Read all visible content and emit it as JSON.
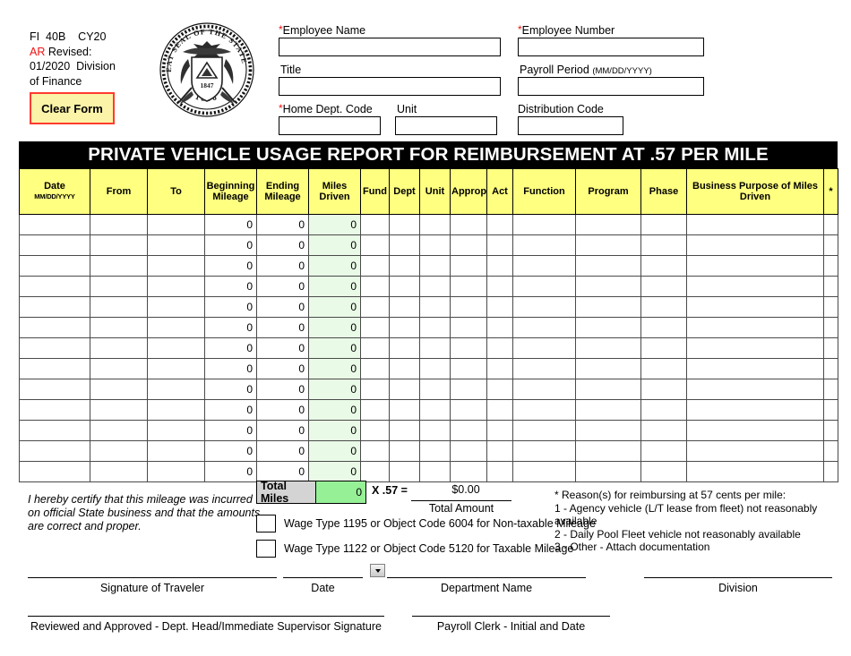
{
  "meta": {
    "line1": "FI  40B    CY20",
    "line2_prefix": "AR",
    "line2_rest": " Revised:",
    "line3": "01/2020  Division",
    "line4": "of Finance",
    "clear_form_label": "Clear Form"
  },
  "seal": {
    "outer_text": "THE GREAT SEAL OF THE STATE OF UTAH",
    "year": "1896",
    "shield_year": "1847",
    "name": "utah-state-seal"
  },
  "header_fields": {
    "employee_name": {
      "label": "Employee Name",
      "required": true,
      "value": "",
      "placeholder": ""
    },
    "employee_number": {
      "label": "Employee Number",
      "required": true,
      "value": "",
      "placeholder": ""
    },
    "title": {
      "label": "Title",
      "required": false,
      "value": "",
      "placeholder": ""
    },
    "payroll_period": {
      "label": "Payroll Period",
      "hint": "(MM/DD/YYYY)",
      "required": false,
      "value": "",
      "placeholder": ""
    },
    "home_dept_code": {
      "label": "Home Dept. Code",
      "required": true,
      "value": "",
      "placeholder": ""
    },
    "unit": {
      "label": "Unit",
      "required": false,
      "value": "",
      "placeholder": ""
    },
    "distribution_code": {
      "label": "Distribution Code",
      "required": false,
      "value": "",
      "placeholder": ""
    }
  },
  "title_bar": {
    "text": "PRIVATE  VEHICLE USAGE REPORT FOR REIMBURSEMENT AT .57 PER MILE"
  },
  "table": {
    "columns": [
      {
        "label": "Date",
        "sub": "MM/DD/YYYY"
      },
      {
        "label": "From",
        "sub": ""
      },
      {
        "label": "To",
        "sub": ""
      },
      {
        "label": "Beginning Mileage",
        "sub": ""
      },
      {
        "label": "Ending Mileage",
        "sub": ""
      },
      {
        "label": "Miles Driven",
        "sub": ""
      },
      {
        "label": "Fund",
        "sub": ""
      },
      {
        "label": "Dept",
        "sub": ""
      },
      {
        "label": "Unit",
        "sub": ""
      },
      {
        "label": "Approp",
        "sub": ""
      },
      {
        "label": "Act",
        "sub": ""
      },
      {
        "label": "Function",
        "sub": ""
      },
      {
        "label": "Program",
        "sub": ""
      },
      {
        "label": "Phase",
        "sub": ""
      },
      {
        "label": "Business Purpose of Miles Driven",
        "sub": ""
      },
      {
        "label": "*",
        "sub": ""
      }
    ],
    "row_count": 13,
    "zero_value": "0",
    "blank_value": ""
  },
  "totals": {
    "total_miles_label": "Total Miles",
    "total_miles_value": "0",
    "rate_text": "X  .57 =",
    "total_amount_value": "$0.00",
    "total_amount_label": "Total Amount"
  },
  "certification": {
    "text": "I hereby certify that this mileage was incurred on official State business and that the amounts are correct and proper."
  },
  "wage_options": [
    {
      "label": "Wage Type 1195 or Object Code 6004 for Non-taxable Mileage",
      "checked": false
    },
    {
      "label": "Wage Type 1122 or Object Code 5120 for Taxable Mileage",
      "checked": false
    }
  ],
  "reasons": {
    "heading": "* Reason(s) for reimbursing at 57 cents per mile:",
    "items": [
      "1 - Agency vehicle (L/T lease from fleet) not reasonably available",
      "2 - Daily Pool Fleet vehicle not reasonably available",
      "3 - Other - Attach documentation"
    ]
  },
  "signatures": {
    "traveler": "Signature of Traveler",
    "date": "Date",
    "department_name": "Department Name",
    "division": "Division",
    "reviewed": "Reviewed and Approved - Dept. Head/Immediate Supervisor Signature",
    "payroll_clerk": "Payroll Clerk - Initial and Date"
  },
  "colors": {
    "header_yellow": "#ffff80",
    "miles_green": "#e9fbe6",
    "total_green": "#96f096",
    "required_red": "#ee1111",
    "clear_form_bg": "#fbf3a8",
    "clear_form_border": "#ff3b30",
    "title_bar_bg": "#000000"
  }
}
